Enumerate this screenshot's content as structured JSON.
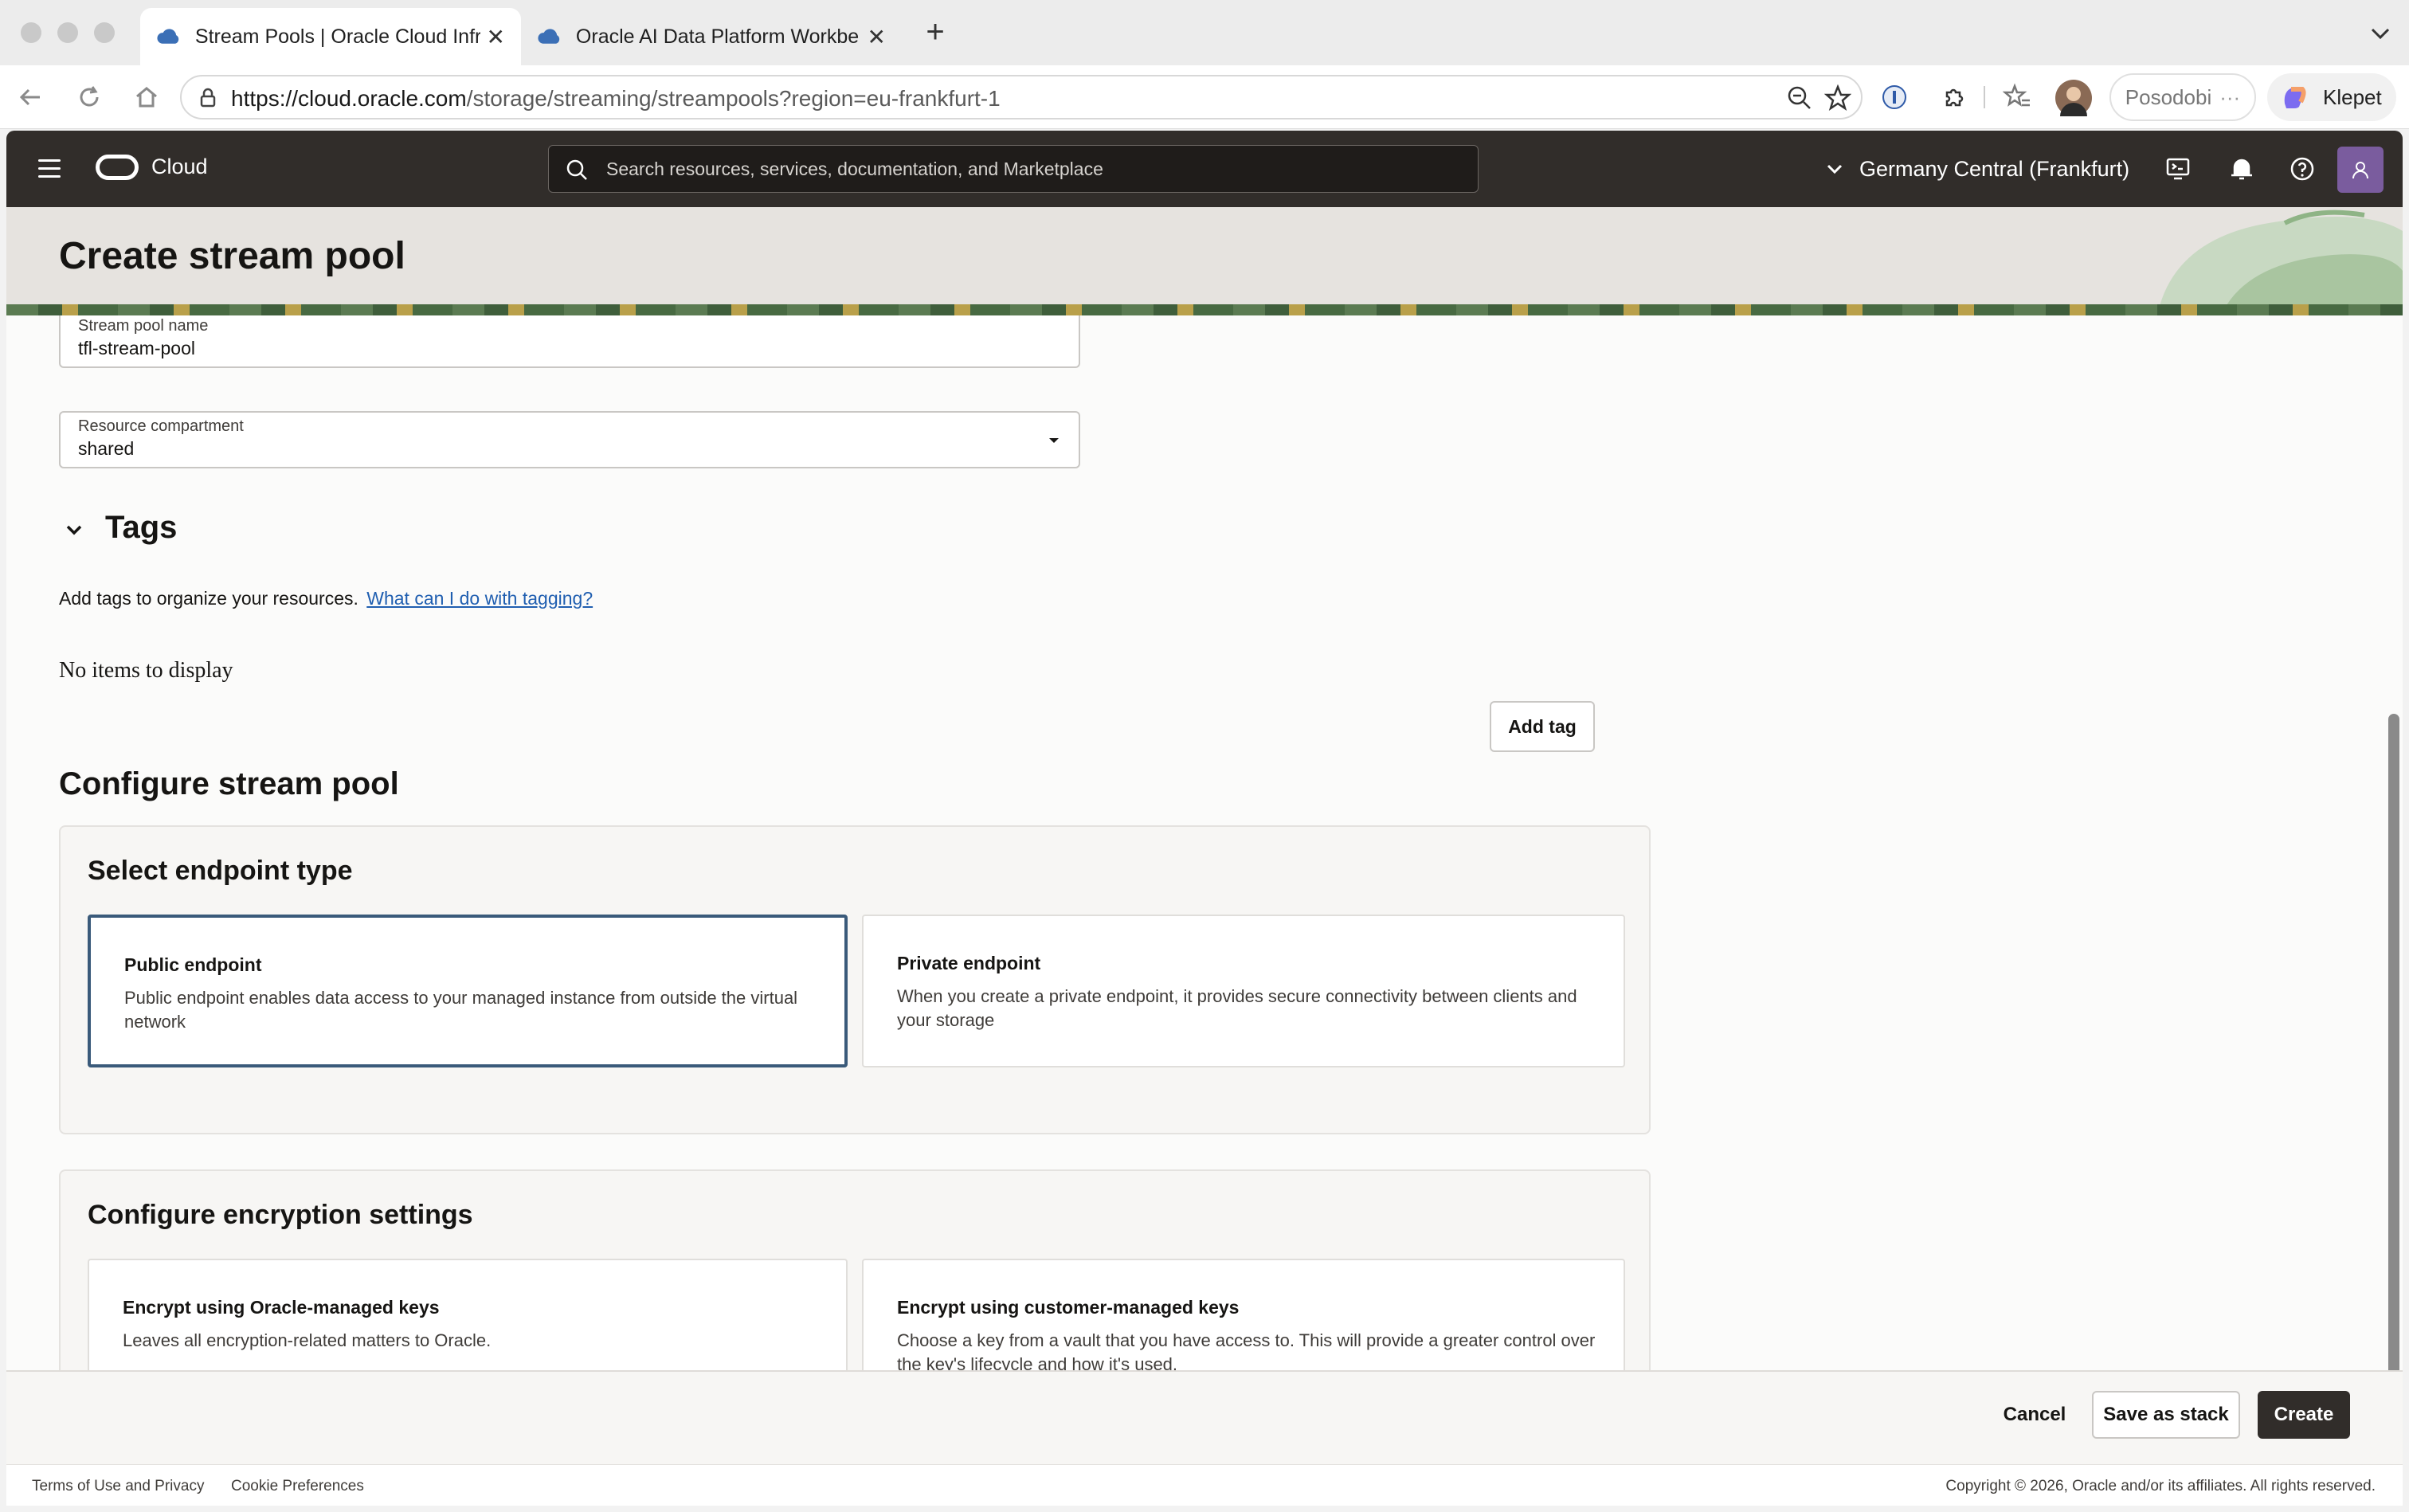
{
  "browser": {
    "tabs": [
      {
        "title": "Stream Pools | Oracle Cloud Infr",
        "active": true
      },
      {
        "title": "Oracle AI Data Platform Workbe",
        "active": false
      }
    ],
    "url_host": "https://cloud.oracle.com",
    "url_path": "/storage/streaming/streampools?region=eu-frankfurt-1",
    "profile_label": "Posodobi",
    "copilot_label": "Klepet"
  },
  "oci_header": {
    "brand": "Cloud",
    "search_placeholder": "Search resources, services, documentation, and Marketplace",
    "region": "Germany Central (Frankfurt)"
  },
  "page": {
    "title": "Create stream pool"
  },
  "form": {
    "name_field": {
      "label": "Stream pool name",
      "value": "tfl-stream-pool"
    },
    "compartment_field": {
      "label": "Resource compartment",
      "value": "shared"
    },
    "tags": {
      "heading": "Tags",
      "help_text": "Add tags to organize your resources.",
      "help_link": "What can I do with tagging?",
      "empty_text": "No items to display",
      "add_button": "Add tag"
    },
    "configure": {
      "heading": "Configure stream pool",
      "endpoint": {
        "heading": "Select endpoint type",
        "options": [
          {
            "title": "Public endpoint",
            "desc": "Public endpoint enables data access to your managed instance from outside the virtual network",
            "selected": true
          },
          {
            "title": "Private endpoint",
            "desc": "When you create a private endpoint, it provides secure connectivity between clients and your storage",
            "selected": false
          }
        ]
      },
      "encryption": {
        "heading": "Configure encryption settings",
        "options": [
          {
            "title": "Encrypt using Oracle-managed keys",
            "desc": "Leaves all encryption-related matters to Oracle."
          },
          {
            "title": "Encrypt using customer-managed keys",
            "desc": "Choose a key from a vault that you have access to. This will provide a greater control over the key's lifecycle and how it's used."
          }
        ]
      }
    }
  },
  "actions": {
    "cancel": "Cancel",
    "save_stack": "Save as stack",
    "create": "Create"
  },
  "legal": {
    "terms": "Terms of Use and Privacy",
    "cookies": "Cookie Preferences",
    "copyright": "Copyright © 2026, Oracle and/or its affiliates. All rights reserved."
  }
}
